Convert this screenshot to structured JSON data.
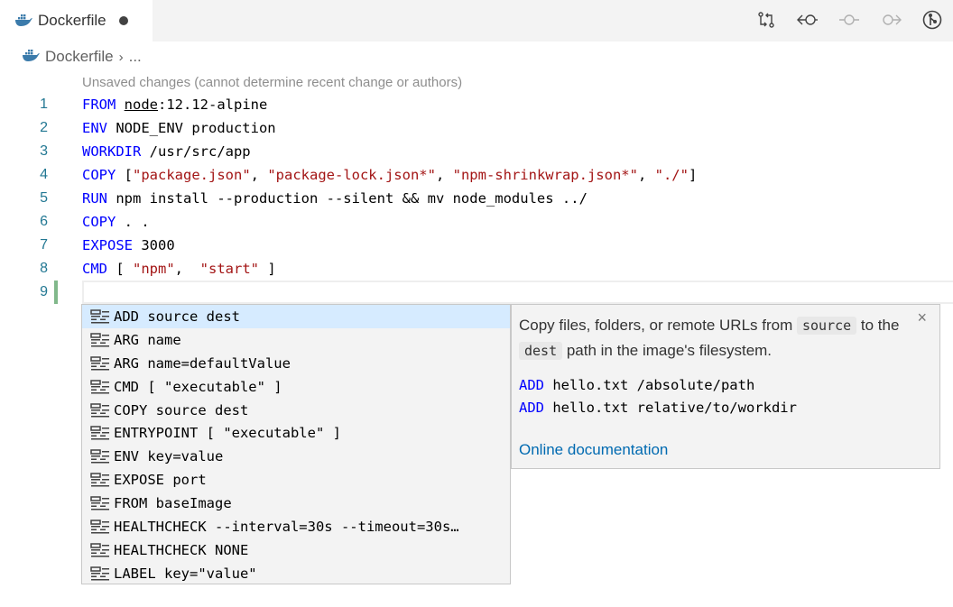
{
  "tab": {
    "label": "Dockerfile",
    "dirty": true,
    "icon": "docker-whale-icon"
  },
  "actions": [
    {
      "name": "open-changes-icon",
      "disabled": false
    },
    {
      "name": "previous-change-icon",
      "disabled": false
    },
    {
      "name": "current-commit-icon",
      "disabled": true
    },
    {
      "name": "next-change-icon",
      "disabled": true
    },
    {
      "name": "git-graph-icon",
      "disabled": false
    }
  ],
  "breadcrumb": {
    "file": "Dockerfile",
    "separator": "›",
    "more": "..."
  },
  "blame": "Unsaved changes (cannot determine recent change or authors)",
  "editor": {
    "lines": [
      {
        "n": "1",
        "kw": "FROM",
        "rest": [
          {
            "t": " "
          },
          {
            "t": "node",
            "c": "ul"
          },
          {
            "t": ":12.12-alpine"
          }
        ]
      },
      {
        "n": "2",
        "kw": "ENV",
        "rest": [
          {
            "t": " NODE_ENV production"
          }
        ]
      },
      {
        "n": "3",
        "kw": "WORKDIR",
        "rest": [
          {
            "t": " /usr/src/app"
          }
        ]
      },
      {
        "n": "4",
        "kw": "COPY",
        "rest": [
          {
            "t": " ["
          },
          {
            "t": "\"package.json\"",
            "c": "str"
          },
          {
            "t": ", "
          },
          {
            "t": "\"package-lock.json*\"",
            "c": "str"
          },
          {
            "t": ", "
          },
          {
            "t": "\"npm-shrinkwrap.json*\"",
            "c": "str"
          },
          {
            "t": ", "
          },
          {
            "t": "\"./\"",
            "c": "str"
          },
          {
            "t": "]"
          }
        ]
      },
      {
        "n": "5",
        "kw": "RUN",
        "rest": [
          {
            "t": " npm install --production --silent && mv node_modules ../"
          }
        ]
      },
      {
        "n": "6",
        "kw": "COPY",
        "rest": [
          {
            "t": " . ."
          }
        ]
      },
      {
        "n": "7",
        "kw": "EXPOSE",
        "rest": [
          {
            "t": " 3000"
          }
        ]
      },
      {
        "n": "8",
        "kw": "CMD",
        "rest": [
          {
            "t": " [ "
          },
          {
            "t": "\"npm\"",
            "c": "str"
          },
          {
            "t": ",  "
          },
          {
            "t": "\"start\"",
            "c": "str"
          },
          {
            "t": " ]"
          }
        ]
      },
      {
        "n": "9",
        "kw": "",
        "rest": [],
        "current": true
      }
    ]
  },
  "suggestions": {
    "selected_index": 0,
    "items": [
      {
        "label": "ADD source dest"
      },
      {
        "label": "ARG name"
      },
      {
        "label": "ARG name=defaultValue"
      },
      {
        "label": "CMD [ \"executable\" ]"
      },
      {
        "label": "COPY source dest"
      },
      {
        "label": "ENTRYPOINT [ \"executable\" ]"
      },
      {
        "label": "ENV key=value"
      },
      {
        "label": "EXPOSE port"
      },
      {
        "label": "FROM baseImage"
      },
      {
        "label": "HEALTHCHECK --interval=30s --timeout=30s…"
      },
      {
        "label": "HEALTHCHECK NONE"
      },
      {
        "label": "LABEL key=\"value\""
      }
    ]
  },
  "details": {
    "desc_part1": "Copy files, folders, or remote URLs from ",
    "desc_code1": "source",
    "desc_part2": " to the ",
    "desc_code2": "dest",
    "desc_part3": " path in the image's filesystem.",
    "example1_kw": "ADD",
    "example1_rest": " hello.txt /absolute/path",
    "example2_kw": "ADD",
    "example2_rest": " hello.txt relative/to/workdir",
    "link": "Online documentation",
    "close": "×"
  },
  "colors": {
    "keyword": "#0000ff",
    "string": "#a31515",
    "line_number": "#237893",
    "selection": "#d6ebff",
    "link": "#006ab1",
    "gutter_added": "#81b88b"
  }
}
